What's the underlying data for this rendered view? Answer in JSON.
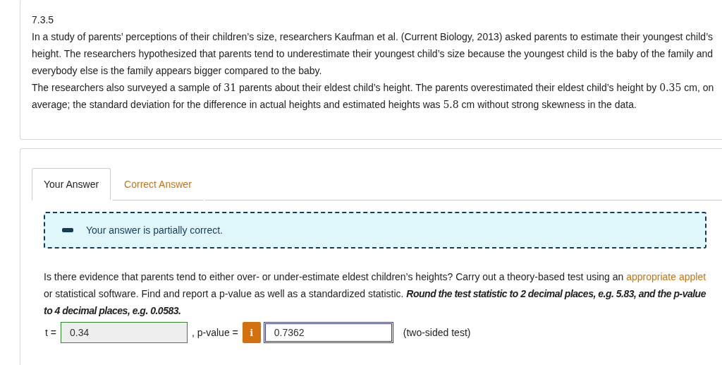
{
  "problem": {
    "number": "7.3.5",
    "paragraphs": [
      [
        {
          "kind": "text",
          "text": "In a study of parents’ perceptions of their children’s size, researchers Kaufman et al. (Current Biology, 2013) asked parents to estimate their youngest child’s height. The researchers hypothesized that parents tend to underestimate their youngest child’s size because the youngest child is the baby of the family and everybody else is the family appears bigger compared to the baby."
        }
      ],
      [
        {
          "kind": "text",
          "text": "The researchers also surveyed a sample of "
        },
        {
          "kind": "math",
          "text": "31"
        },
        {
          "kind": "text",
          "text": " parents about their eldest child’s height. The parents overestimated their eldest child’s height by "
        },
        {
          "kind": "math",
          "text": "0.35"
        },
        {
          "kind": "text",
          "text": " cm, on average; the standard deviation for the difference in actual heights and estimated heights was "
        },
        {
          "kind": "math",
          "text": "5.8"
        },
        {
          "kind": "text",
          "text": " cm without strong skewness in the data."
        }
      ]
    ]
  },
  "tabs": [
    {
      "label": "Your Answer",
      "selected": true
    },
    {
      "label": "Correct Answer",
      "selected": false
    }
  ],
  "feedback": {
    "kind": "partial",
    "message": "Your answer is partially correct."
  },
  "question": [
    {
      "kind": "text",
      "text": "Is there evidence that parents tend to either over- or under-estimate eldest children’s heights? Carry out a theory-based test using an "
    },
    {
      "kind": "link",
      "text": "appropriate applet"
    },
    {
      "kind": "text",
      "text": " or statistical software. Find and report a p-value as well as a standardized statistic. "
    },
    {
      "kind": "emphasis",
      "text": "Round the test statistic to 2 decimal places, e.g. 5.83, and the p-value to 4 decimal places, e.g. 0.0583."
    }
  ],
  "answers": {
    "t_label": "t =",
    "t_value": "0.34",
    "t_correct": true,
    "p_label": ", p-value =",
    "info_icon": "i",
    "p_value": "0.7362",
    "p_focused": true,
    "note": "(two-sided test)"
  }
}
